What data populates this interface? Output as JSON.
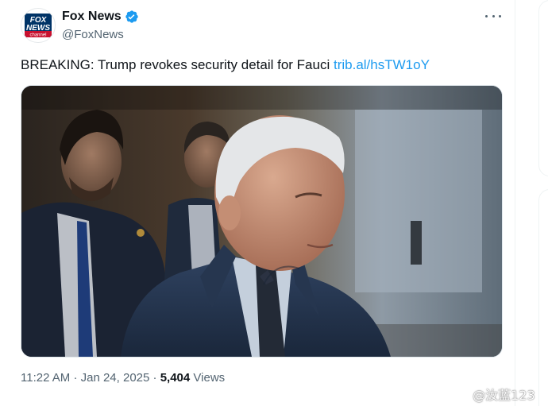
{
  "author": {
    "display_name": "Fox News",
    "handle": "@FoxNews",
    "verified": true,
    "avatar_logo_text": [
      "FOX",
      "NEWS",
      "channel"
    ]
  },
  "tweet": {
    "text": "BREAKING: Trump revokes security detail for Fauci",
    "link_text": "trib.al/hsTW1oY",
    "time": "11:22 AM",
    "date": "Jan 24, 2025",
    "separator": "·",
    "views_count": "5,404",
    "views_label": "Views"
  },
  "watermark": "@汝蓝123",
  "icons": {
    "verified": "verified-badge-icon",
    "more": "more-options-icon",
    "watermark": "weibo-icon"
  },
  "colors": {
    "link": "#1d9bf0",
    "verified": "#1d9bf0",
    "secondary_text": "#536471",
    "primary_text": "#0f1419"
  }
}
